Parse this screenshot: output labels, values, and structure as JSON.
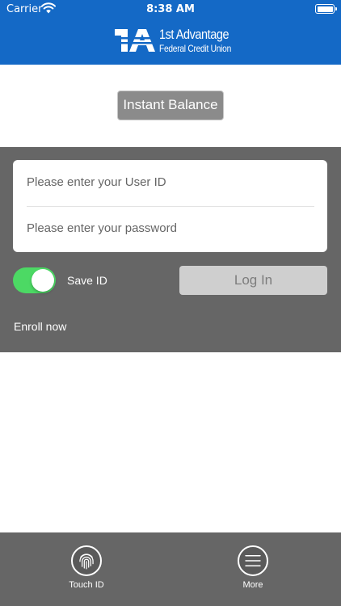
{
  "status_bar": {
    "carrier": "Carrier",
    "time": "8:38 AM"
  },
  "brand": {
    "mark": "1A",
    "name": "1st Advantage",
    "sub": "Federal Credit Union",
    "color": "#1469c6"
  },
  "instant_balance": {
    "label": "Instant Balance"
  },
  "login": {
    "user_placeholder": "Please enter your User ID",
    "password_placeholder": "Please enter your password",
    "save_id_label": "Save ID",
    "save_id_on": true,
    "login_label": "Log In",
    "enroll_label": "Enroll now"
  },
  "tabbar": {
    "touch_id": {
      "label": "Touch ID",
      "icon": "fingerprint-icon"
    },
    "more": {
      "label": "More",
      "icon": "menu-icon"
    }
  },
  "colors": {
    "toggle_on": "#4cd964",
    "panel": "#666666"
  }
}
